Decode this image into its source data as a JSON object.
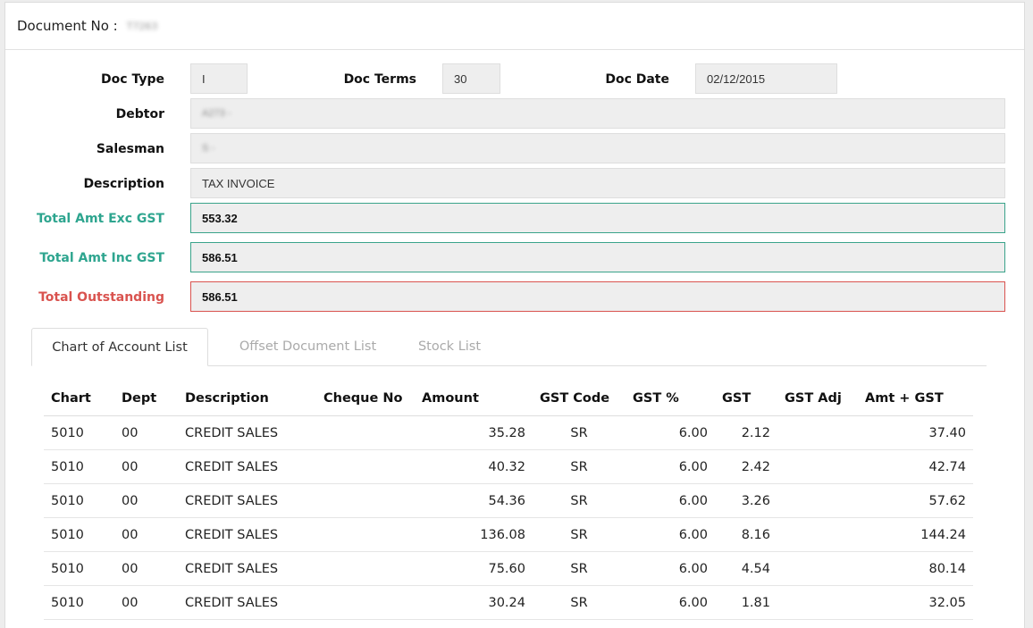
{
  "header": {
    "doc_no_label": "Document No :",
    "doc_no_value": "T7263"
  },
  "form": {
    "doc_type_label": "Doc Type",
    "doc_type_value": "I",
    "doc_terms_label": "Doc Terms",
    "doc_terms_value": "30",
    "doc_date_label": "Doc Date",
    "doc_date_value": "02/12/2015",
    "debtor_label": "Debtor",
    "debtor_value": "A273 -",
    "salesman_label": "Salesman",
    "salesman_value": "S -",
    "description_label": "Description",
    "description_value": "TAX INVOICE",
    "total_exc_label": "Total Amt Exc GST",
    "total_exc_value": "553.32",
    "total_inc_label": "Total Amt Inc GST",
    "total_inc_value": "586.51",
    "total_outstanding_label": "Total Outstanding",
    "total_outstanding_value": "586.51"
  },
  "tabs": [
    {
      "label": "Chart of Account List",
      "active": true
    },
    {
      "label": "Offset Document List",
      "active": false
    },
    {
      "label": "Stock List",
      "active": false
    }
  ],
  "table": {
    "columns": [
      "Chart",
      "Dept",
      "Description",
      "Cheque No",
      "Amount",
      "GST Code",
      "GST %",
      "GST",
      "GST Adj",
      "Amt + GST"
    ],
    "rows": [
      [
        "5010",
        "00",
        "CREDIT SALES",
        "",
        "35.28",
        "SR",
        "6.00",
        "2.12",
        "",
        "37.40"
      ],
      [
        "5010",
        "00",
        "CREDIT SALES",
        "",
        "40.32",
        "SR",
        "6.00",
        "2.42",
        "",
        "42.74"
      ],
      [
        "5010",
        "00",
        "CREDIT SALES",
        "",
        "54.36",
        "SR",
        "6.00",
        "3.26",
        "",
        "57.62"
      ],
      [
        "5010",
        "00",
        "CREDIT SALES",
        "",
        "136.08",
        "SR",
        "6.00",
        "8.16",
        "",
        "144.24"
      ],
      [
        "5010",
        "00",
        "CREDIT SALES",
        "",
        "75.60",
        "SR",
        "6.00",
        "4.54",
        "",
        "80.14"
      ],
      [
        "5010",
        "00",
        "CREDIT SALES",
        "",
        "30.24",
        "SR",
        "6.00",
        "1.81",
        "",
        "32.05"
      ]
    ]
  },
  "colors": {
    "accent_teal": "#2ea58f",
    "accent_red": "#d9534f"
  }
}
